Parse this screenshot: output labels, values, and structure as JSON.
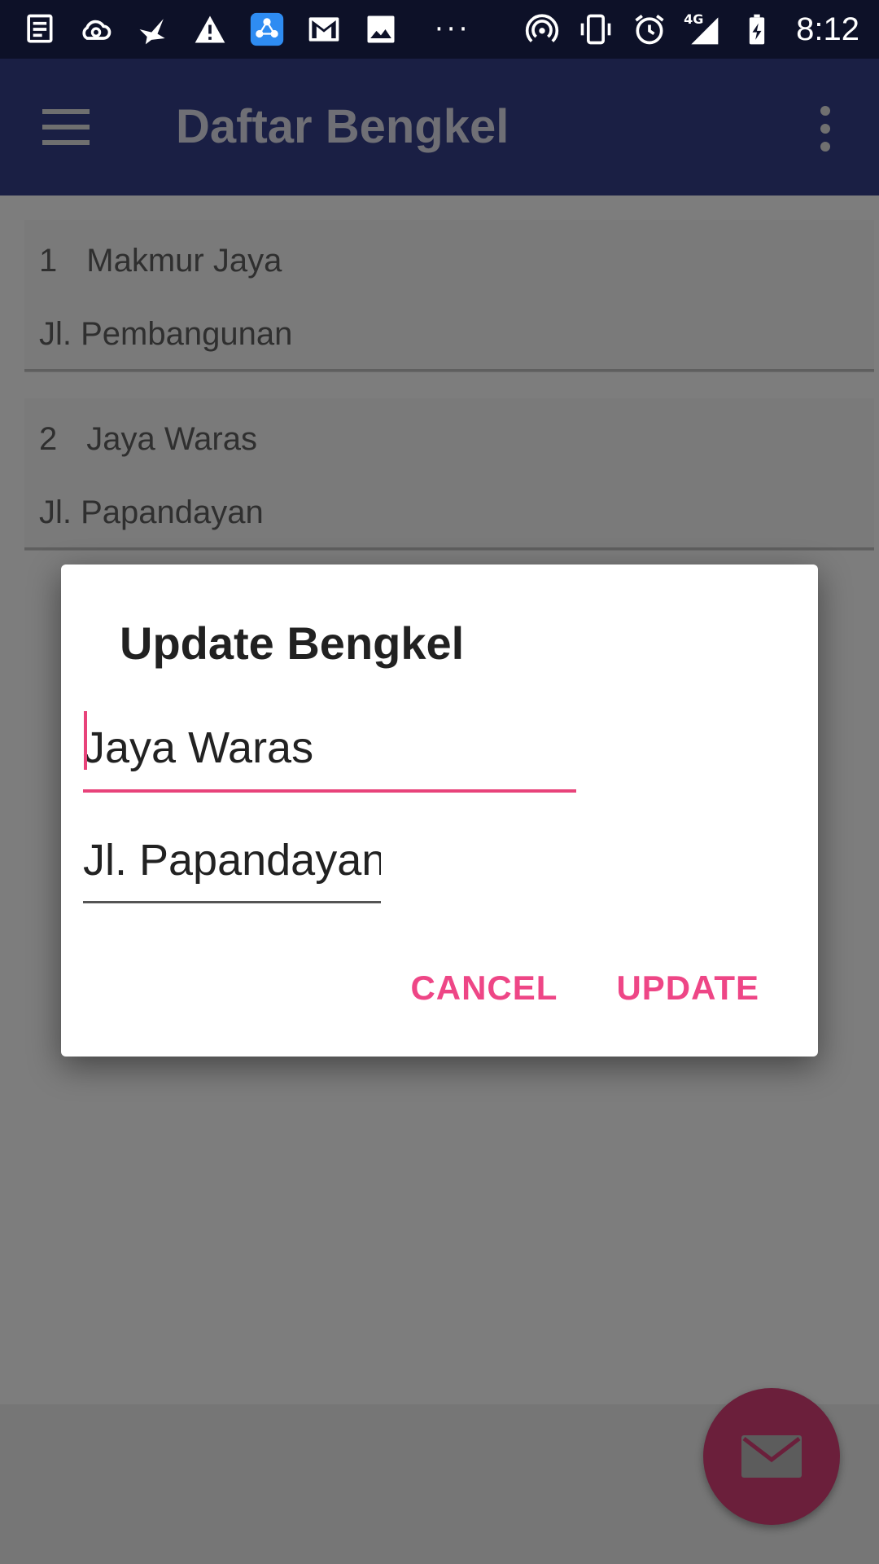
{
  "status_bar": {
    "time": "8:12",
    "network_type": "4G",
    "left_icons": [
      "news-icon",
      "cloud-link-icon",
      "bird-icon",
      "warning-icon",
      "share-icon",
      "gmail-icon",
      "gallery-icon"
    ],
    "overflow_dots": "···",
    "right_icons": [
      "hotspot-icon",
      "vibrate-icon",
      "alarm-icon",
      "signal-icon",
      "battery-charging-icon"
    ]
  },
  "app_bar": {
    "title": "Daftar Bengkel"
  },
  "list": [
    {
      "number": "1",
      "name": "Makmur Jaya",
      "address": "Jl. Pembangunan"
    },
    {
      "number": "2",
      "name": "Jaya Waras",
      "address": "Jl. Papandayan"
    }
  ],
  "dialog": {
    "title": "Update Bengkel",
    "name_value": "Jaya Waras",
    "address_value": "Jl. Papandayan",
    "cancel_label": "CANCEL",
    "update_label": "UPDATE"
  },
  "fab": {
    "icon": "email-icon"
  },
  "colors": {
    "accent": "#e8437a",
    "app_bar": "#1a1f44",
    "status_bar": "#0d1128",
    "fab": "#6b1f3b"
  }
}
